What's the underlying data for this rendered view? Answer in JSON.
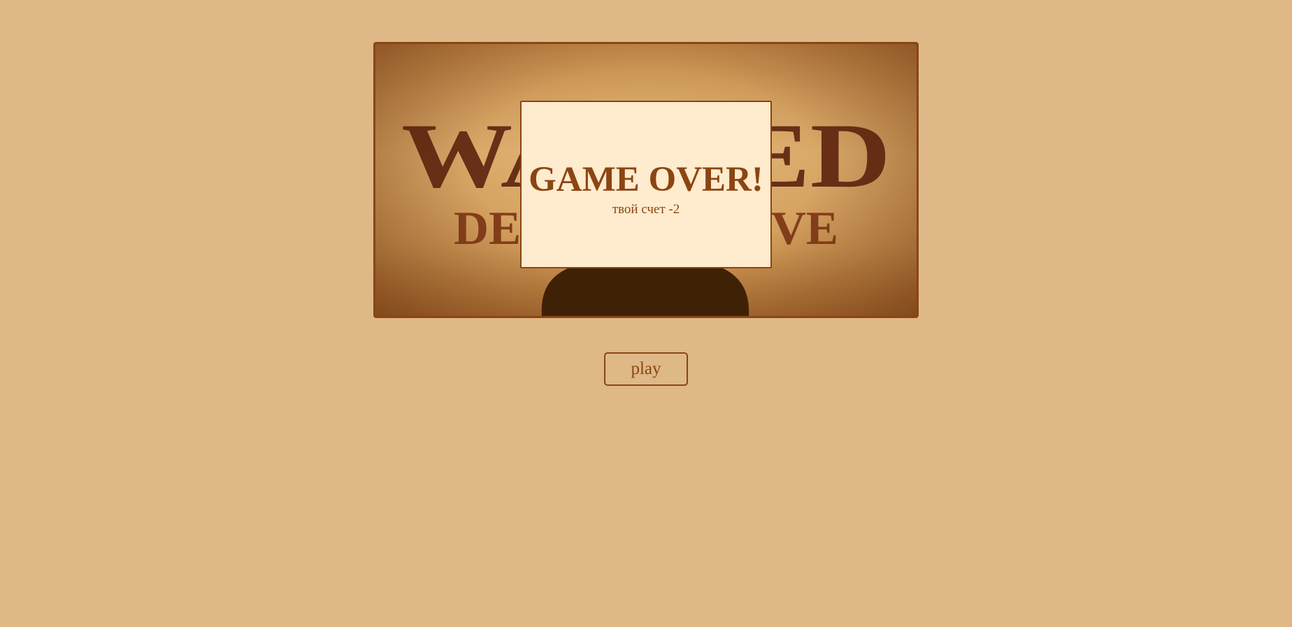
{
  "poster": {
    "image": "wanted-dead-or-alive-poster"
  },
  "game_over": {
    "title": "GAME OVER!",
    "score_text": "твой счет -2"
  },
  "controls": {
    "play_label": "play"
  },
  "colors": {
    "background": "#deb887",
    "accent": "#8b4513",
    "dialog_background": "#ffebcd"
  }
}
